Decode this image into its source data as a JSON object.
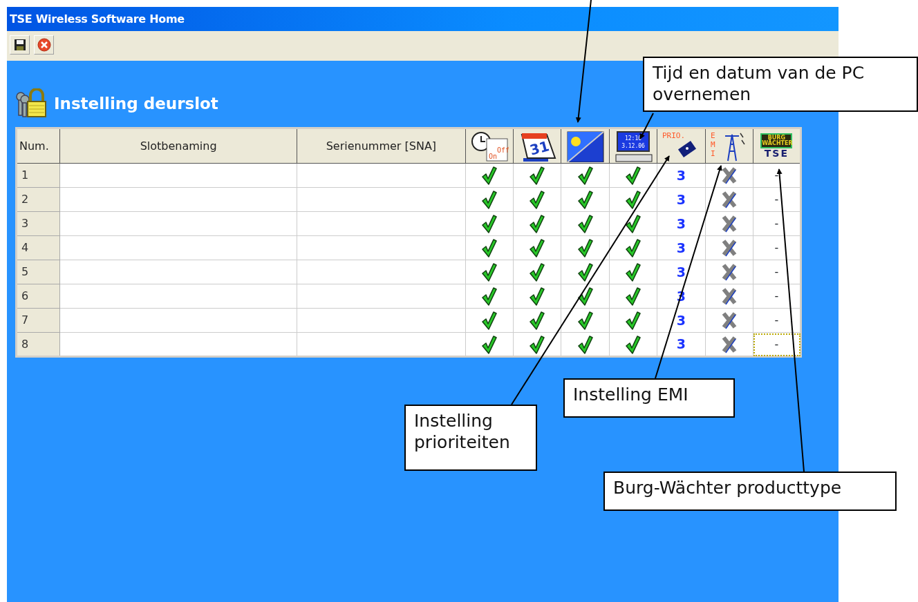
{
  "window": {
    "title": "TSE Wireless Software Home"
  },
  "toolbar": {
    "buttons": [
      {
        "kind": "save"
      },
      {
        "kind": "close"
      }
    ]
  },
  "heading": "Instelling deurslot",
  "table": {
    "columns": [
      {
        "kind": "text",
        "label": "Num."
      },
      {
        "kind": "text",
        "label": "Slotbenaming"
      },
      {
        "kind": "text",
        "label": "Serienummer [SNA]"
      },
      {
        "kind": "clock",
        "icon_text": [
          "On",
          "Off"
        ]
      },
      {
        "kind": "calendar",
        "icon_text": [
          "31"
        ]
      },
      {
        "kind": "weather"
      },
      {
        "kind": "pc",
        "icon_text": [
          "12:10",
          "3.12.06"
        ]
      },
      {
        "kind": "prio",
        "icon_text": [
          "PRIO."
        ]
      },
      {
        "kind": "emi",
        "icon_text": [
          "E",
          "M",
          "I"
        ]
      },
      {
        "kind": "brand",
        "icon_text": [
          "BURG WÄCHTER",
          "TSE"
        ]
      }
    ],
    "rows": [
      {
        "num": "1",
        "checks": [
          true,
          true,
          true,
          true
        ],
        "prio": "3",
        "emi": false,
        "type": "-",
        "focused": false
      },
      {
        "num": "2",
        "checks": [
          true,
          true,
          true,
          true
        ],
        "prio": "3",
        "emi": false,
        "type": "-",
        "focused": false
      },
      {
        "num": "3",
        "checks": [
          true,
          true,
          true,
          true
        ],
        "prio": "3",
        "emi": false,
        "type": "-",
        "focused": false
      },
      {
        "num": "4",
        "checks": [
          true,
          true,
          true,
          true
        ],
        "prio": "3",
        "emi": false,
        "type": "-",
        "focused": false
      },
      {
        "num": "5",
        "checks": [
          true,
          true,
          true,
          true
        ],
        "prio": "3",
        "emi": false,
        "type": "-",
        "focused": false
      },
      {
        "num": "6",
        "checks": [
          true,
          true,
          true,
          true
        ],
        "prio": "3",
        "emi": false,
        "type": "-",
        "focused": false
      },
      {
        "num": "7",
        "checks": [
          true,
          true,
          true,
          true
        ],
        "prio": "3",
        "emi": false,
        "type": "-",
        "focused": false
      },
      {
        "num": "8",
        "checks": [
          true,
          true,
          true,
          true
        ],
        "prio": "3",
        "emi": false,
        "type": "-",
        "focused": true
      }
    ]
  },
  "callouts": [
    {
      "text": "Tijd en datum van de PC overnemen"
    },
    {
      "text": "Instelling prioriteiten"
    },
    {
      "text": "Instelling EMI"
    },
    {
      "text": "Burg-Wächter producttype"
    }
  ]
}
